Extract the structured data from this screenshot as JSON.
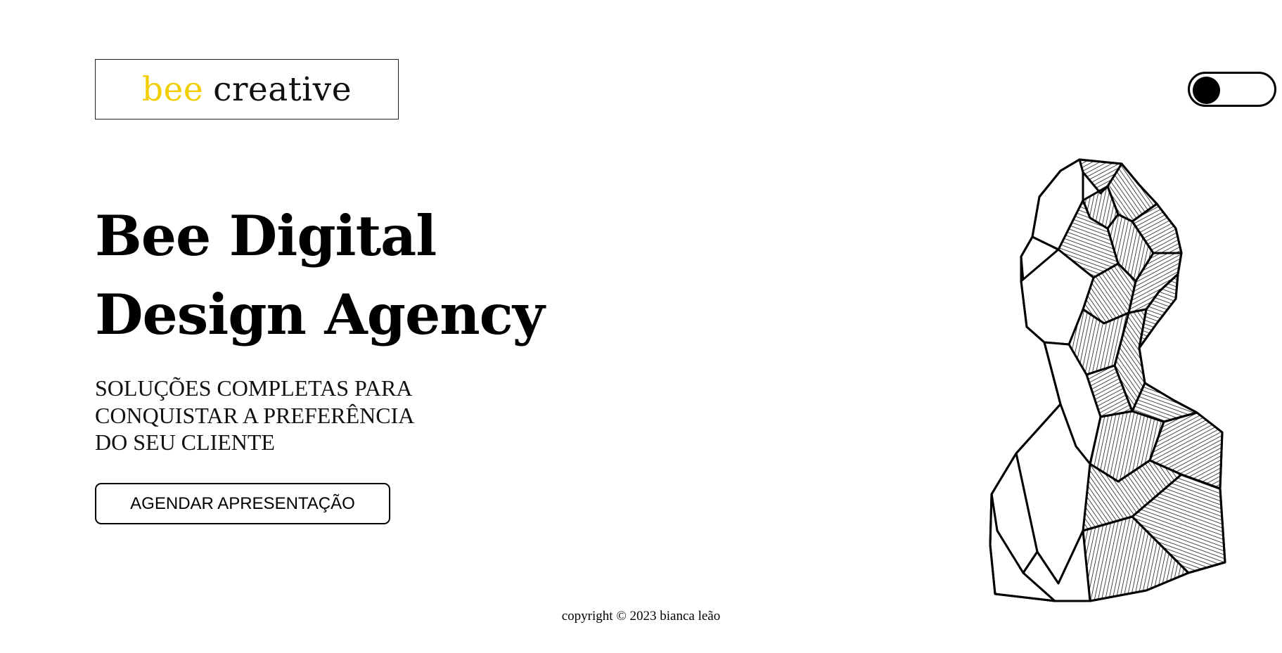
{
  "header": {
    "logo": {
      "word1": "bee",
      "word2": "creative",
      "accent_color": "#f2cd00"
    },
    "theme_toggle": {
      "icon": "toggle-switch-icon",
      "state": "off"
    }
  },
  "hero": {
    "title_line1": "Bee Digital",
    "title_line2": "Design Agency",
    "subtitle_line1": "SOLUÇÕES COMPLETAS PARA",
    "subtitle_line2": "CONQUISTAR A PREFERÊNCIA",
    "subtitle_line3": "DO SEU CLIENTE",
    "cta_label": "AGENDAR APRESENTAÇÃO",
    "illustration": "geometric-head-bust-illustration"
  },
  "footer": {
    "copyright": "copyright © 2023 bianca leão"
  }
}
